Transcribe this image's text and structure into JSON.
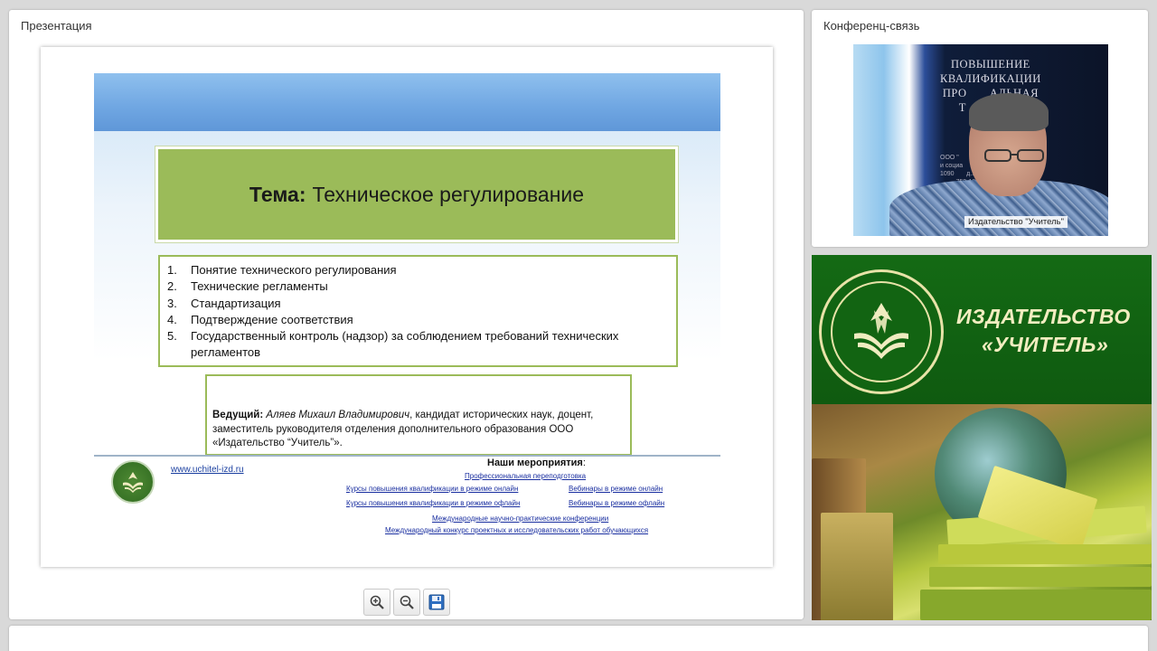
{
  "panels": {
    "presentation_title": "Презентация",
    "conference_title": "Конференц-связь"
  },
  "slide": {
    "title_bold": "Тема:",
    "title_rest": "Техническое регулирование",
    "list": [
      {
        "num": "1.",
        "text": "Понятие технического регулирования"
      },
      {
        "num": "2.",
        "text": "Технические регламенты"
      },
      {
        "num": "3.",
        "text": "Стандартизация"
      },
      {
        "num": "4.",
        "text": "Подтверждение соответствия"
      },
      {
        "num": "5.",
        "text": "Государственный контроль (надзор) за соблюдением требований технических регламентов"
      }
    ],
    "presenter_label": "Ведущий:",
    "presenter_name": "Аляев Михаил Владимирович",
    "presenter_desc": ", кандидат исторических наук, доцент, заместитель руководителя отделения дополнительного образования ООО «Издательство “Учитель”».",
    "footer_url": "www.uchitel-izd.ru",
    "events_title": "Наши мероприятия",
    "events_title_suffix": ":",
    "events": {
      "retraining": "Профессиональная переподготовка",
      "courses_online": "Курсы повышения квалификации в режиме онлайн",
      "webinars_online": "Вебинары в режиме онлайн",
      "courses_offline": "Курсы повышения квалификации в режиме офлайн",
      "webinars_offline": "Вебинары в режиме офлайн",
      "conferences": "Международные научно-практические конференции",
      "contest": "Международный конкурс проектных и исследовательских работ обучающихся"
    }
  },
  "toolbar": {
    "zoom_in": "zoom-in-icon",
    "zoom_out": "zoom-out-icon",
    "save": "save-icon"
  },
  "video": {
    "bg_lines": [
      "ПОВЫШЕНИЕ",
      "КВАЛИФИКАЦИИ",
      "ПРО       АЛЬНАЯ",
      "Т       ОВКА"
    ],
    "bg_small": [
      "ООО \"       ования",
      "и социа        ледований\"",
      "1090       д.16, стр. 1",
      "         753-18-08"
    ],
    "caption": "Издательство \"Учитель\""
  },
  "banner": {
    "name_line1": "ИЗДАТЕЛЬСТВО",
    "name_line2": "«УЧИТЕЛЬ»"
  },
  "colors": {
    "slide_green": "#9bbb59",
    "banner_green": "#146a14",
    "banner_text": "#f2edc0",
    "link_blue": "#1a2fa0"
  }
}
